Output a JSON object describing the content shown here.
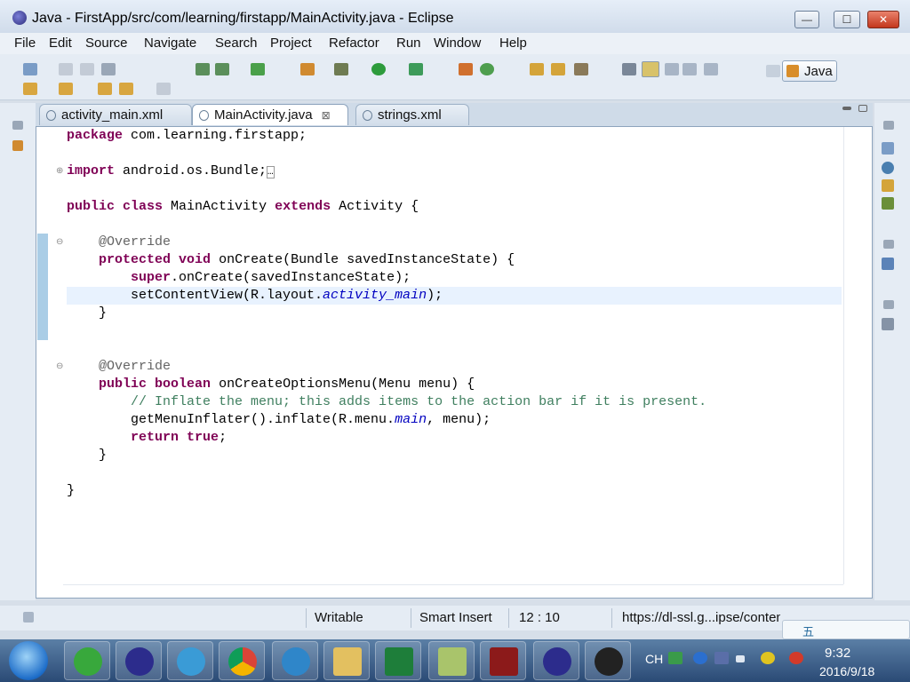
{
  "window": {
    "title": "Java - FirstApp/src/com/learning/firstapp/MainActivity.java - Eclipse",
    "minimize": "—",
    "maximize": "☐",
    "close": "✕"
  },
  "menu": [
    "File",
    "Edit",
    "Source",
    "Navigate",
    "Search",
    "Project",
    "Refactor",
    "Run",
    "Window",
    "Help"
  ],
  "perspective": {
    "label": "Java"
  },
  "tabs": [
    {
      "label": "activity_main.xml",
      "active": false
    },
    {
      "label": "MainActivity.java",
      "active": true,
      "close": "⊠"
    },
    {
      "label": "strings.xml",
      "active": false
    }
  ],
  "code": [
    "package com.learning.firstapp;",
    "",
    "import android.os.Bundle;",
    "",
    "public class MainActivity extends Activity {",
    "",
    "    @Override",
    "    protected void onCreate(Bundle savedInstanceState) {",
    "        super.onCreate(savedInstanceState);",
    "        setContentView(R.layout.activity_main);",
    "    }",
    "",
    "",
    "    @Override",
    "    public boolean onCreateOptionsMenu(Menu menu) {",
    "        // Inflate the menu; this adds items to the action bar if it is present.",
    "        getMenuInflater().inflate(R.menu.main, menu);",
    "        return true;",
    "    }",
    "",
    "}"
  ],
  "status": {
    "writable": "Writable",
    "insert_mode": "Smart Insert",
    "position": "12 : 10",
    "url": "https://dl-ssl.g...ipse/content.xml"
  },
  "tray": {
    "lang": "CH",
    "ime_text": "五"
  },
  "clock": {
    "time": "9:32",
    "date": "2016/9/18"
  },
  "colors": {
    "keyword": "#7f0055",
    "annotation": "#646464",
    "comment": "#3f7f5f",
    "field": "#0000c0"
  }
}
